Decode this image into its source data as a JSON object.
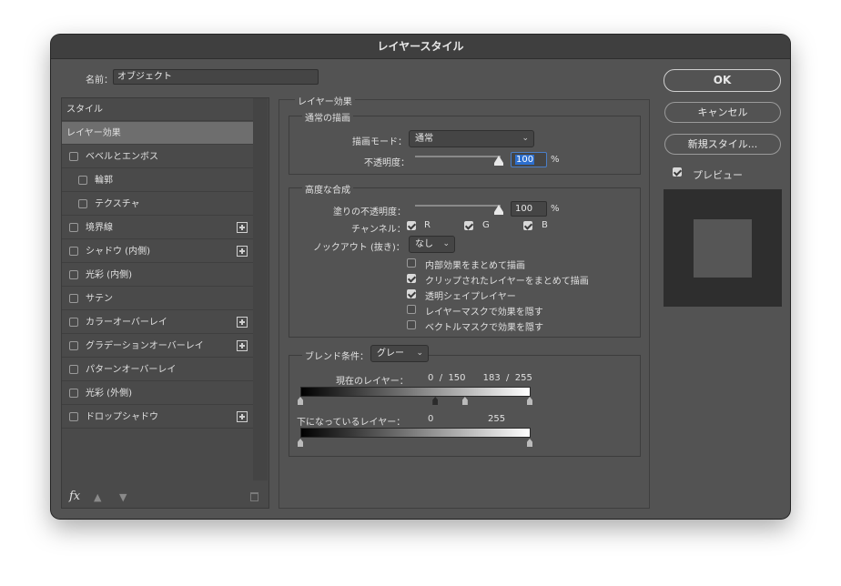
{
  "title": "レイヤースタイル",
  "name_field": {
    "label": "名前：",
    "value": "オブジェクト"
  },
  "styles_list": {
    "items": [
      {
        "label": "スタイル",
        "checkbox": false,
        "checked": false,
        "plus": false,
        "indent": 0,
        "selected": false
      },
      {
        "label": "レイヤー効果",
        "checkbox": false,
        "checked": false,
        "plus": false,
        "indent": 0,
        "selected": true
      },
      {
        "label": "ベベルとエンボス",
        "checkbox": true,
        "checked": false,
        "plus": false,
        "indent": 0,
        "selected": false
      },
      {
        "label": "輪郭",
        "checkbox": true,
        "checked": false,
        "plus": false,
        "indent": 1,
        "selected": false
      },
      {
        "label": "テクスチャ",
        "checkbox": true,
        "checked": false,
        "plus": false,
        "indent": 1,
        "selected": false
      },
      {
        "label": "境界線",
        "checkbox": true,
        "checked": false,
        "plus": true,
        "indent": 0,
        "selected": false
      },
      {
        "label": "シャドウ (内側)",
        "checkbox": true,
        "checked": false,
        "plus": true,
        "indent": 0,
        "selected": false
      },
      {
        "label": "光彩 (内側)",
        "checkbox": true,
        "checked": false,
        "plus": false,
        "indent": 0,
        "selected": false
      },
      {
        "label": "サテン",
        "checkbox": true,
        "checked": false,
        "plus": false,
        "indent": 0,
        "selected": false
      },
      {
        "label": "カラーオーバーレイ",
        "checkbox": true,
        "checked": false,
        "plus": true,
        "indent": 0,
        "selected": false
      },
      {
        "label": "グラデーションオーバーレイ",
        "checkbox": true,
        "checked": false,
        "plus": true,
        "indent": 0,
        "selected": false
      },
      {
        "label": "パターンオーバーレイ",
        "checkbox": true,
        "checked": false,
        "plus": false,
        "indent": 0,
        "selected": false
      },
      {
        "label": "光彩 (外側)",
        "checkbox": true,
        "checked": false,
        "plus": false,
        "indent": 0,
        "selected": false
      },
      {
        "label": "ドロップシャドウ",
        "checkbox": true,
        "checked": false,
        "plus": true,
        "indent": 0,
        "selected": false
      }
    ],
    "fx_label": "fx"
  },
  "layer_effects": {
    "title": "レイヤー効果",
    "normal": {
      "title": "通常の描画",
      "blend_mode_label": "描画モード：",
      "blend_mode_value": "通常",
      "opacity_label": "不透明度：",
      "opacity_value": "100",
      "opacity_unit": "%",
      "opacity_fraction": 1.0
    },
    "advanced": {
      "title": "高度な合成",
      "fill_opacity_label": "塗りの不透明度：",
      "fill_opacity_value": "100",
      "fill_opacity_unit": "%",
      "fill_opacity_fraction": 1.0,
      "channels_label": "チャンネル：",
      "channels": [
        {
          "label": "R",
          "checked": true
        },
        {
          "label": "G",
          "checked": true
        },
        {
          "label": "B",
          "checked": true
        }
      ],
      "knockout_label": "ノックアウト (抜き)：",
      "knockout_value": "なし",
      "options": [
        {
          "label": "内部効果をまとめて描画",
          "checked": false
        },
        {
          "label": "クリップされたレイヤーをまとめて描画",
          "checked": true
        },
        {
          "label": "透明シェイプレイヤー",
          "checked": true
        },
        {
          "label": "レイヤーマスクで効果を隠す",
          "checked": false
        },
        {
          "label": "ベクトルマスクで効果を隠す",
          "checked": false
        }
      ]
    },
    "blend_if": {
      "label": "ブレンド条件：",
      "value": "グレー",
      "this_layer_label": "現在のレイヤー：",
      "this_layer_values": "0  /  150      183  /  255",
      "this_layer_stops": [
        0,
        150,
        183,
        255
      ],
      "underlying_label": "下になっているレイヤー：",
      "underlying_low": "0",
      "underlying_high": "255",
      "underlying_stops": [
        0,
        255
      ]
    }
  },
  "buttons": {
    "ok": "OK",
    "cancel": "キャンセル",
    "new_style": "新規スタイル..."
  },
  "preview": {
    "label": "プレビュー",
    "checked": true
  }
}
